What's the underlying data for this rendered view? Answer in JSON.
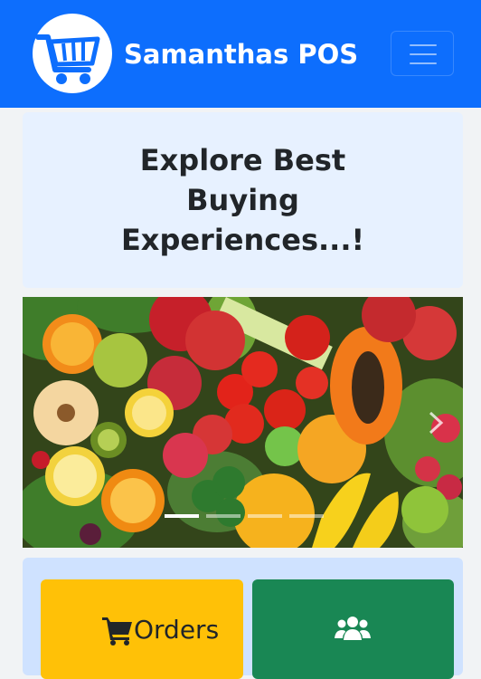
{
  "navbar": {
    "brand": "Samanthas POS",
    "logo_icon": "shopping-cart-logo-icon",
    "menu_icon": "hamburger-menu-icon",
    "color": "#0d6efd"
  },
  "hero": {
    "heading": "Explore Best Buying Experiences...!",
    "color": "#e7f1ff"
  },
  "carousel": {
    "image": "fresh fruits and vegetables",
    "slides": 4,
    "active_slide": 1,
    "next_icon": "chevron-right-icon"
  },
  "dashboard": {
    "cards": [
      {
        "label": "Orders",
        "icon": "shopping-cart-icon",
        "color": "#ffc107"
      },
      {
        "label": "",
        "icon": "users-icon",
        "color": "#198754"
      }
    ]
  }
}
